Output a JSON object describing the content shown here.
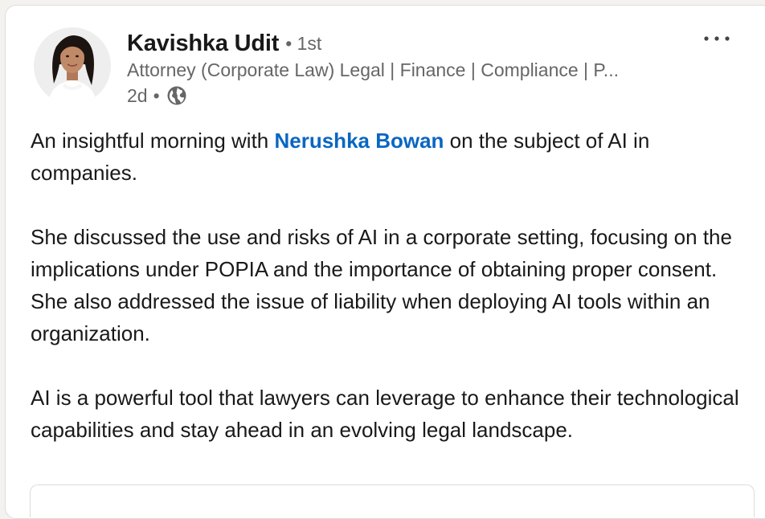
{
  "post": {
    "author": {
      "name": "Kavishka Udit",
      "degree": "• 1st",
      "headline": "Attorney (Corporate Law) Legal | Finance | Compliance | P...",
      "age": "2d",
      "separator": "•",
      "visibility_icon": "globe-icon"
    },
    "more_menu_icon": "ellipsis-icon",
    "body": {
      "p1_pre": "An insightful morning with ",
      "p1_mention": "Nerushka Bowan",
      "p1_post": " on the subject of AI in companies.",
      "p2": "She discussed the use and risks of AI in a corporate setting, focusing on the implications under POPIA and the importance of obtaining proper consent. She also addressed the issue of liability when deploying AI tools within an organization.",
      "p3": "AI is a powerful tool that lawyers can leverage to enhance their technological capabilities and stay ahead in an evolving legal landscape."
    }
  },
  "colors": {
    "mention": "#0a66c2",
    "secondary_text": "#666666",
    "primary_text": "#191919"
  }
}
